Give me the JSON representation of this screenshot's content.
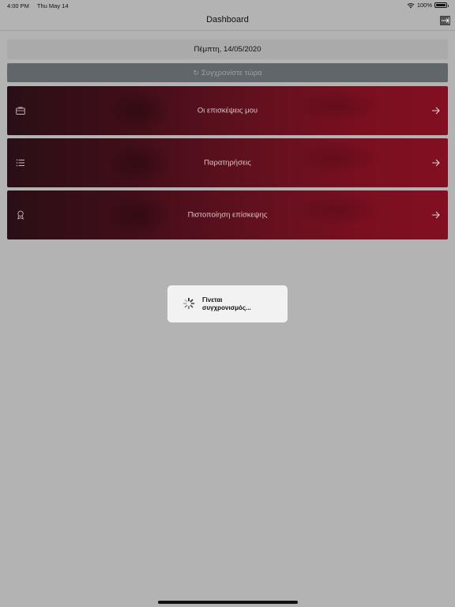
{
  "status_bar": {
    "time": "4:00 PM",
    "date": "Thu May 14",
    "battery": "100%",
    "wifi_icon": "wifi-icon",
    "battery_icon": "battery-icon"
  },
  "nav": {
    "title": "Dashboard",
    "logout_icon": "logout-icon"
  },
  "date_bar": {
    "text": "Πέμπτη, 14/05/2020"
  },
  "sync_button": {
    "label": "Συγχρονίστε τώρα",
    "icon": "refresh-icon"
  },
  "menu": [
    {
      "label": "Οι επισκέψεις μου",
      "icon": "briefcase-icon",
      "arrow_icon": "arrow-right-icon"
    },
    {
      "label": "Παρατηρήσεις",
      "icon": "list-icon",
      "arrow_icon": "arrow-right-icon"
    },
    {
      "label": "Πιστοποίηση επίσκεψης",
      "icon": "award-icon",
      "arrow_icon": "arrow-right-icon"
    }
  ],
  "loading_hud": {
    "line1": "Γίνεται",
    "line2": "συγχρονισμός...",
    "icon": "spinner-icon"
  },
  "colors": {
    "background": "#b3b3b3",
    "sync_button": "#61666b",
    "card_dark": "#2a0f16",
    "card_accent": "#820f22",
    "hud_background": "#f2f2f2"
  }
}
